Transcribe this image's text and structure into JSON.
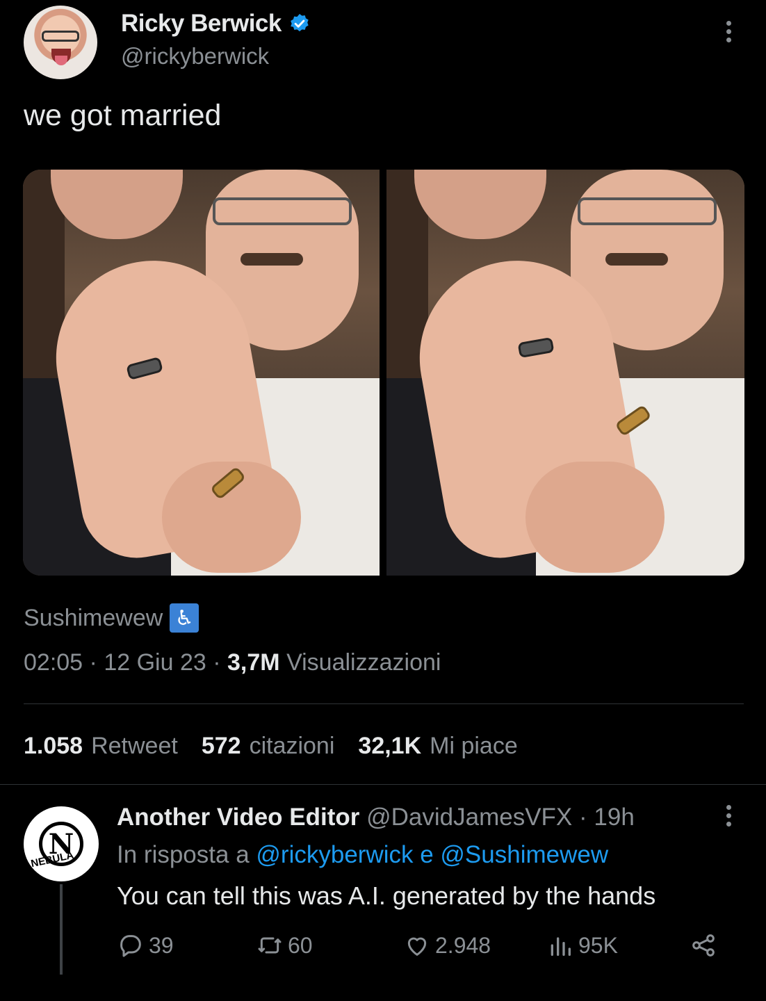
{
  "tweet": {
    "author_name": "Ricky Berwick",
    "author_handle": "@rickyberwick",
    "text": "we got married",
    "source": "Sushimewew",
    "time": "02:05",
    "date": "12 Giu 23",
    "views_count": "3,7M",
    "views_label": "Visualizzazioni",
    "sep": "·",
    "stats": {
      "retweets_count": "1.058",
      "retweets_label": "Retweet",
      "quotes_count": "572",
      "quotes_label": "citazioni",
      "likes_count": "32,1K",
      "likes_label": "Mi piace"
    }
  },
  "reply": {
    "author_name": "Another Video Editor",
    "author_handle": "@DavidJamesVFX",
    "age": "19h",
    "avatar_text": "N",
    "avatar_brand": "NEBULA",
    "reply_prefix": "In risposta a",
    "mentions": "@rickyberwick e @Sushimewew",
    "text": "You can tell this was A.I. generated by the hands",
    "actions": {
      "replies": "39",
      "retweets": "60",
      "likes": "2.948",
      "views": "95K"
    }
  },
  "colors": {
    "background": "#000000",
    "text_primary": "#e7e9ea",
    "text_secondary": "#8b9095",
    "accent": "#1d9bf0",
    "divider": "#2f3336"
  },
  "icons": [
    "verified-badge-icon",
    "more-icon",
    "wheelchair-icon",
    "reply-icon",
    "retweet-icon",
    "like-icon",
    "views-icon",
    "share-icon"
  ]
}
